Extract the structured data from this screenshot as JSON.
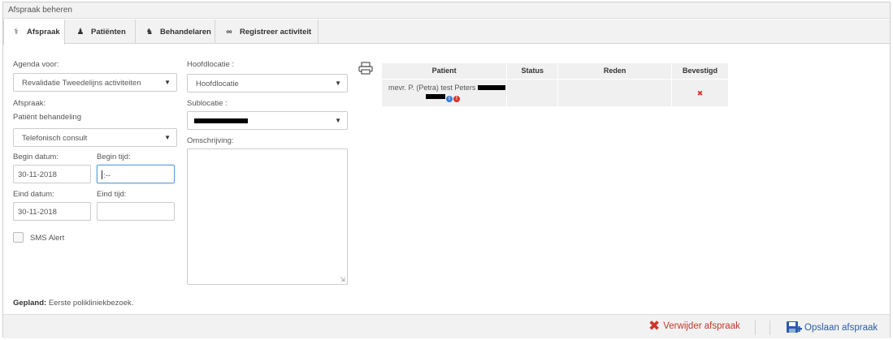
{
  "window": {
    "title": "Afspraak beheren"
  },
  "tabs": [
    {
      "label": "Afspraak",
      "icon": "stethoscope-icon"
    },
    {
      "label": "Patiënten",
      "icon": "user-icon"
    },
    {
      "label": "Behandelaren",
      "icon": "doctor-icon"
    },
    {
      "label": "Registreer activiteit",
      "icon": "link-icon"
    }
  ],
  "form": {
    "agenda_label": "Agenda voor:",
    "agenda_value": "Revalidatie Tweedelijns activiteiten",
    "afspraak_label": "Afspraak:",
    "afspraak_sublabel": "Patiënt behandeling",
    "afspraak_value": "Telefonisch consult",
    "begin_datum_label": "Begin datum:",
    "begin_datum_value": "30-11-2018",
    "begin_tijd_label": "Begin tijd:",
    "begin_tijd_value": ":--",
    "eind_datum_label": "Eind datum:",
    "eind_datum_value": "30-11-2018",
    "eind_tijd_label": "Eind tijd:",
    "eind_tijd_value": "",
    "sms_label": "SMS Alert",
    "hoofdlocatie_label": "Hoofdlocatie :",
    "hoofdlocatie_value": "Hoofdlocatie",
    "sublocatie_label": "Sublocatie :",
    "omschrijving_label": "Omschrijving:",
    "gepland_label": "Gepland:",
    "gepland_value": "Eerste polikliniekbezoek."
  },
  "table": {
    "columns": [
      "Patient",
      "Status",
      "Reden",
      "Bevestigd"
    ],
    "rows": [
      {
        "patient": "mevr. P. (Petra) test Peters",
        "status": "",
        "reden": "",
        "bevestigd": "✖"
      }
    ]
  },
  "footer": {
    "delete_label": "Verwijder afspraak",
    "save_label": "Opslaan afspraak"
  },
  "colors": {
    "delete": "#c0392b",
    "save": "#2a5da8",
    "info": "#3a7bd5",
    "error": "#d9342b"
  }
}
